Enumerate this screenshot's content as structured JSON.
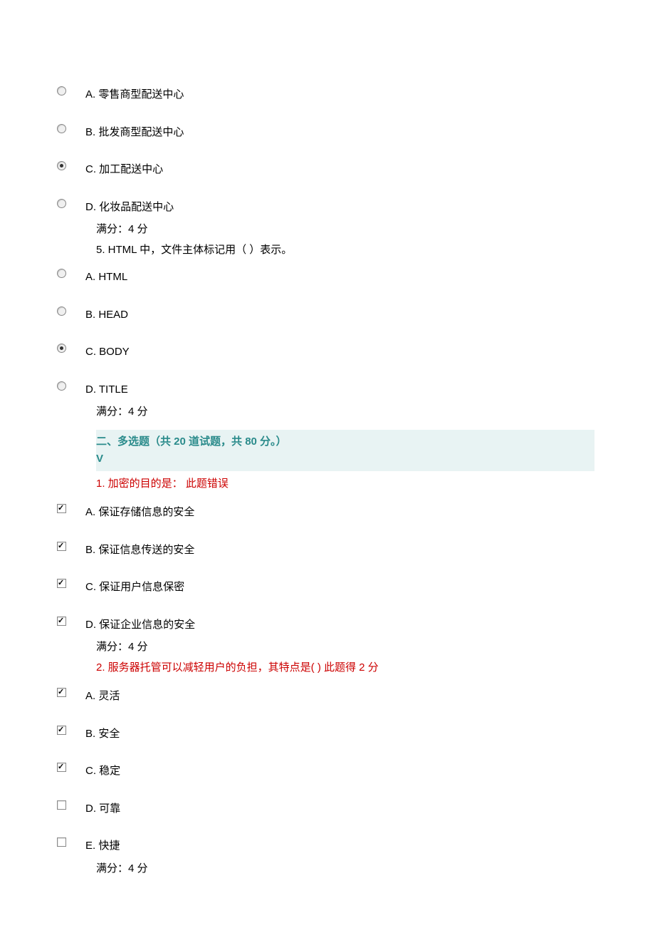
{
  "q4": {
    "options": [
      {
        "letter": "A",
        "text": "A. 零售商型配送中心",
        "selected": false
      },
      {
        "letter": "B",
        "text": "B. 批发商型配送中心",
        "selected": false
      },
      {
        "letter": "C",
        "text": "C. 加工配送中心",
        "selected": true
      },
      {
        "letter": "D",
        "text": "D. 化妆品配送中心",
        "selected": false
      }
    ],
    "score": "满分：4 分"
  },
  "q5": {
    "prompt": "5. HTML 中，文件主体标记用（  ）表示。",
    "options": [
      {
        "letter": "A",
        "text": "A. HTML",
        "selected": false
      },
      {
        "letter": "B",
        "text": "B. HEAD",
        "selected": false
      },
      {
        "letter": "C",
        "text": "C. BODY",
        "selected": true
      },
      {
        "letter": "D",
        "text": "D. TITLE",
        "selected": false
      }
    ],
    "score": "满分：4 分"
  },
  "section2": {
    "title": "二、多选题（共 20 道试题，共 80 分。）",
    "v": "V"
  },
  "mq1": {
    "prompt": "1.  加密的目的是：   此题错误",
    "options": [
      {
        "letter": "A",
        "text": "A. 保证存储信息的安全",
        "checked": true
      },
      {
        "letter": "B",
        "text": "B. 保证信息传送的安全",
        "checked": true
      },
      {
        "letter": "C",
        "text": "C. 保证用户信息保密",
        "checked": true
      },
      {
        "letter": "D",
        "text": "D. 保证企业信息的安全",
        "checked": true
      }
    ],
    "score": "满分：4 分"
  },
  "mq2": {
    "prompt": "2.  服务器托管可以减轻用户的负担，其特点是( ) 此题得 2 分",
    "options": [
      {
        "letter": "A",
        "text": "A. 灵活",
        "checked": true
      },
      {
        "letter": "B",
        "text": "B. 安全",
        "checked": true
      },
      {
        "letter": "C",
        "text": "C. 稳定",
        "checked": true
      },
      {
        "letter": "D",
        "text": "D. 可靠",
        "checked": false
      },
      {
        "letter": "E",
        "text": "E. 快捷",
        "checked": false
      }
    ],
    "score": "满分：4 分"
  }
}
